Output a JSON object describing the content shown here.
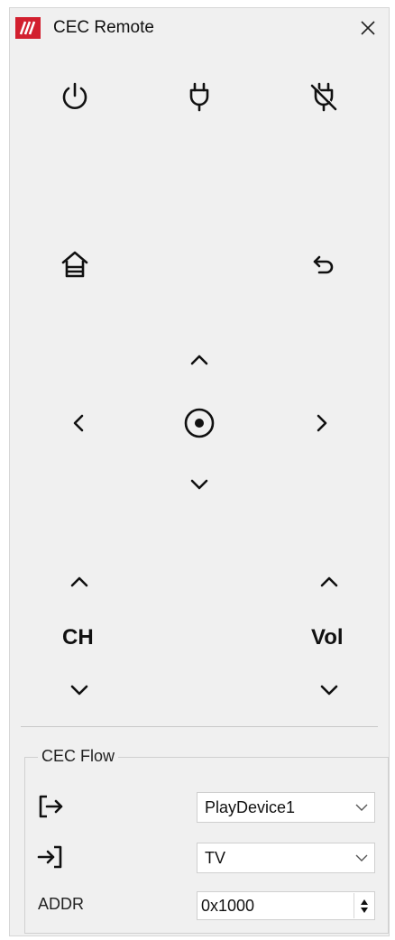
{
  "window": {
    "title": "CEC Remote",
    "brand_color": "#d21f2e",
    "icon": "app-logo-icon",
    "close_icon": "close-icon"
  },
  "remote": {
    "top_buttons": [
      {
        "name": "power-button",
        "icon": "power-icon"
      },
      {
        "name": "plug-button",
        "icon": "plug-icon"
      },
      {
        "name": "unplug-button",
        "icon": "plug-off-icon"
      }
    ],
    "home_icon": "home-icon",
    "back_icon": "back-arrow-icon",
    "dpad": {
      "up_icon": "chevron-up-icon",
      "down_icon": "chevron-down-icon",
      "left_icon": "chevron-left-icon",
      "right_icon": "chevron-right-icon",
      "ok_icon": "record-circle-icon"
    },
    "channel_label": "CH",
    "volume_label": "Vol"
  },
  "cec_flow": {
    "title": "CEC Flow",
    "source_icon": "sign-out-icon",
    "source_value": "PlayDevice1",
    "target_icon": "sign-in-icon",
    "target_value": "TV",
    "addr_label": "ADDR",
    "addr_value": "0x1000"
  }
}
